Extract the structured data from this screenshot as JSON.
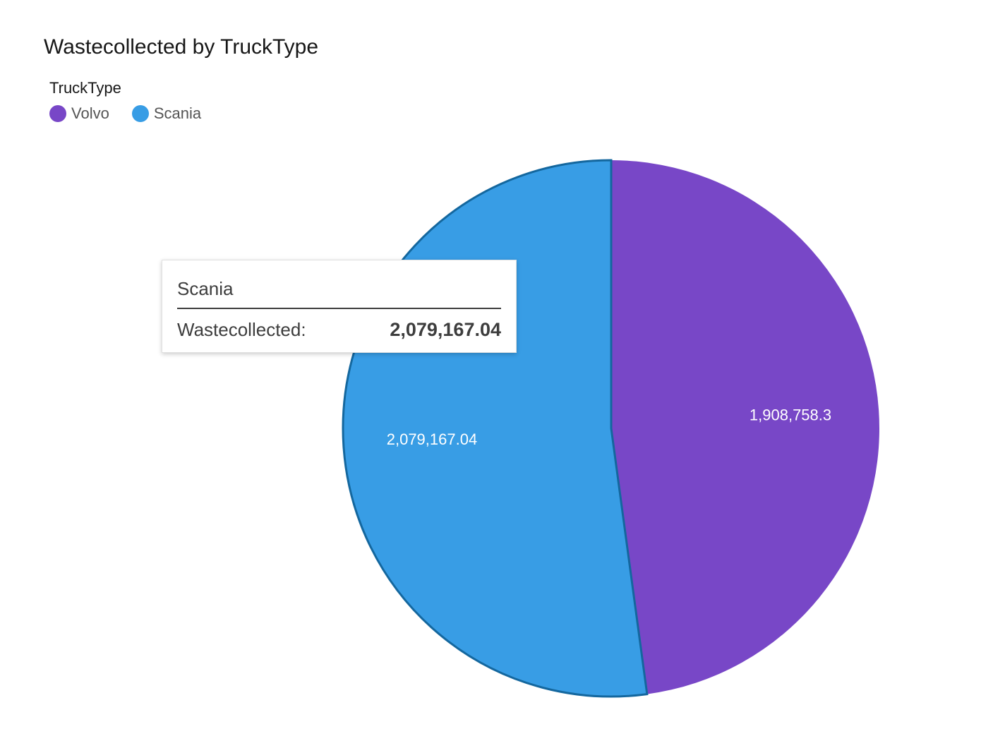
{
  "chart_data": {
    "type": "pie",
    "title": "Wastecollected by TruckType",
    "legend": {
      "title": "TruckType",
      "position": "top-left",
      "items": [
        {
          "name": "Volvo",
          "color": "#7847c7"
        },
        {
          "name": "Scania",
          "color": "#389de5"
        }
      ]
    },
    "categories": [
      "Volvo",
      "Scania"
    ],
    "values": [
      1908758.3,
      2079167.04
    ],
    "data_labels": [
      "1,908,758.3",
      "2,079,167.04"
    ],
    "colors": [
      "#7847c7",
      "#389de5"
    ],
    "highlighted": "Scania"
  },
  "tooltip": {
    "header": "Scania",
    "key": "Wastecollected:",
    "value": "2,079,167.04"
  }
}
